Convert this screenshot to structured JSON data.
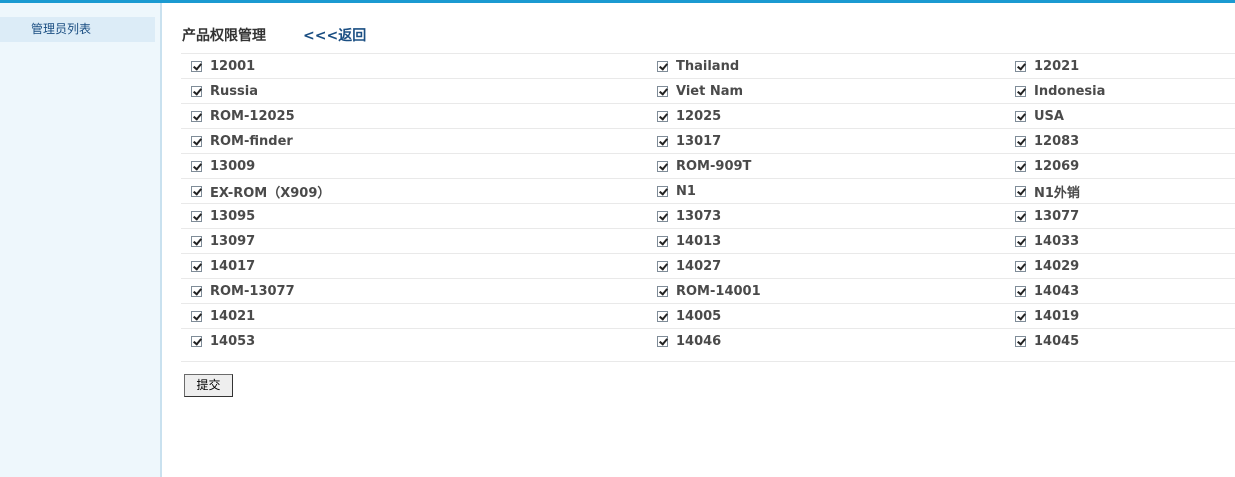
{
  "sidebar": {
    "items": [
      {
        "label": "管理员列表"
      }
    ]
  },
  "header": {
    "title": "产品权限管理",
    "back_label": "<<<返回"
  },
  "permissions": [
    [
      "12001",
      "Thailand",
      "12021"
    ],
    [
      "Russia",
      "Viet Nam",
      "Indonesia"
    ],
    [
      "ROM-12025",
      "12025",
      "USA"
    ],
    [
      "ROM-finder",
      "13017",
      "12083"
    ],
    [
      "13009",
      "ROM-909T",
      "12069"
    ],
    [
      "EX-ROM（X909）",
      "N1",
      "N1外销"
    ],
    [
      "13095",
      "13073",
      "13077"
    ],
    [
      "13097",
      "14013",
      "14033"
    ],
    [
      "14017",
      "14027",
      "14029"
    ],
    [
      "ROM-13077",
      "ROM-14001",
      "14043"
    ],
    [
      "14021",
      "14005",
      "14019"
    ],
    [
      "14053",
      "14046",
      "14045"
    ]
  ],
  "checked": true,
  "submit_label": "提交",
  "colors": {
    "accent": "#1b9ad1",
    "link": "#1a4e82",
    "sidebar_bg": "#eef7fc"
  }
}
